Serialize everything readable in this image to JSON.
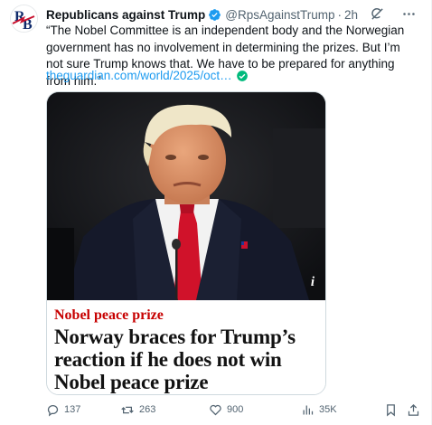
{
  "author": {
    "display_name": "Republicans against Trump",
    "handle": "@RpsAgainstTrump",
    "dot": "·",
    "time": "2h",
    "avatar_icon": "rb-monogram-icon",
    "verified_color": "#1d9bf0"
  },
  "tweet": {
    "text": "“The Nobel Committee is an independent body and the Norwegian government has no involvement in determining the prizes. But I’m not sure Trump knows that. We have to be prepared for anything from him.”",
    "link": "theguardian.com/world/2025/oct…"
  },
  "card": {
    "image_icon": "person-photo-icon",
    "info_badge": "i",
    "kicker": "Nobel peace prize",
    "headline": "Norway braces for Trump’s reaction if he does not win Nobel peace prize",
    "kicker_color": "#c70000"
  },
  "actions": {
    "replies": "137",
    "reposts": "263",
    "likes": "900",
    "views": "35K"
  },
  "colors": {
    "text": "#0f1419",
    "muted": "#536471",
    "link": "#1d9bf0",
    "border": "#cfd9de"
  }
}
